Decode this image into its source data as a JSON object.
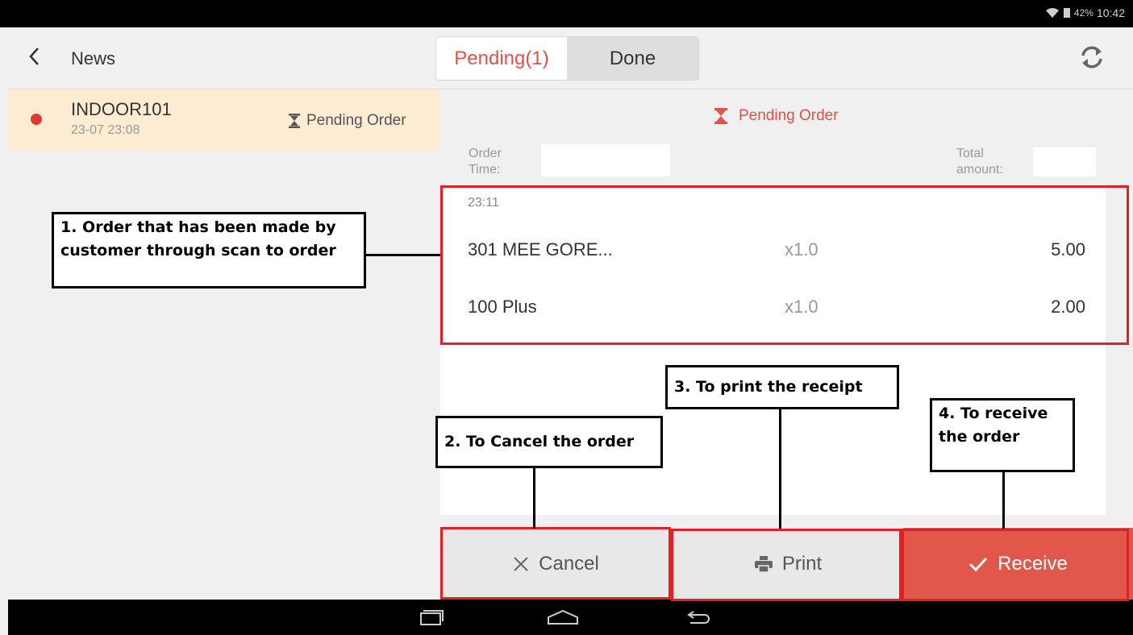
{
  "status_bar": {
    "battery": "42%",
    "time": "10:42"
  },
  "header": {
    "title": "News",
    "tabs": [
      {
        "label": "Pending(1)"
      },
      {
        "label": "Done"
      }
    ]
  },
  "order_list": [
    {
      "name": "INDOOR101",
      "datetime": "23-07 23:08",
      "status": "Pending Order"
    }
  ],
  "detail": {
    "status": "Pending Order",
    "order_time_label": "Order Time:",
    "total_amount_label": "Total amount:",
    "item_time": "23:11",
    "items": [
      {
        "name": "301 MEE GORE...",
        "qty": "x1.0",
        "price": "5.00"
      },
      {
        "name": "100 Plus",
        "qty": "x1.0",
        "price": "2.00"
      }
    ]
  },
  "buttons": {
    "cancel": "Cancel",
    "print": "Print",
    "receive": "Receive"
  },
  "annotations": {
    "a1": "1. Order that has been made by customer through scan to order",
    "a2": "2. To Cancel the order",
    "a3": "3. To print the receipt",
    "a4": "4. To receive the order"
  },
  "colors": {
    "accent": "#e25248",
    "highlight": "#fdebd2",
    "annotation_red": "#e31e24"
  }
}
